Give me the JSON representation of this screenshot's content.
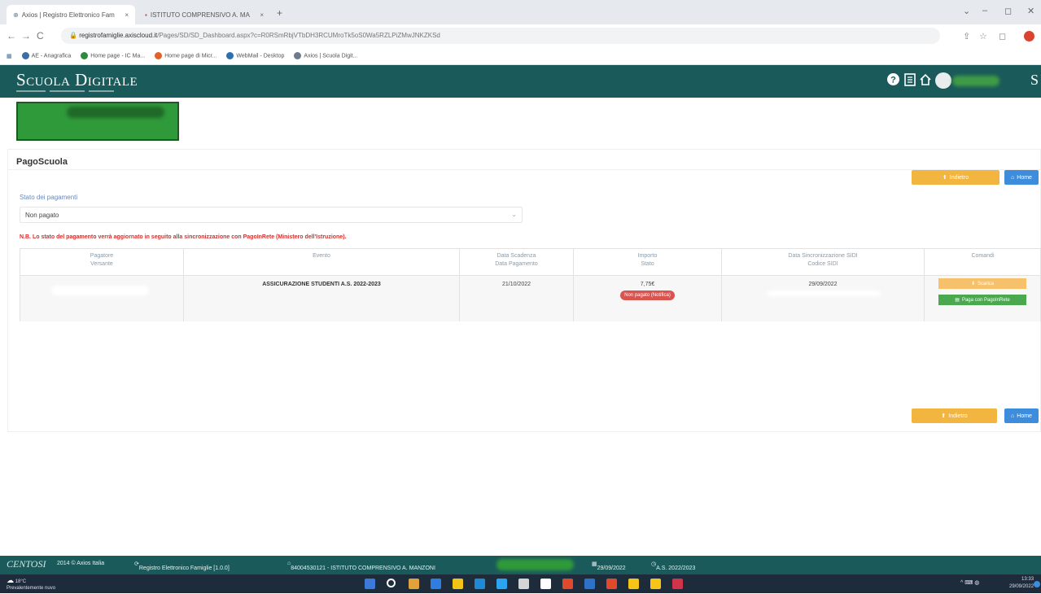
{
  "browser": {
    "tabs": [
      {
        "title": "Axios | Registro Elettronico Fam",
        "active": true,
        "close": "×"
      },
      {
        "title": "ISTITUTO COMPRENSIVO A. MA",
        "active": false,
        "close": "×"
      }
    ],
    "new_tab": "+",
    "window_controls": [
      "⌄",
      "–",
      "◻",
      "✕"
    ],
    "nav": {
      "back": "←",
      "forward": "→",
      "reload": "C"
    },
    "url_host": "registrofamiglie.axiscloud.it",
    "url_path": "/Pages/SD/SD_Dashboard.aspx?c=R0RSmRbjVTbDH3RCUMroTk5oS0Wa5RZLPiZMwJNKZKSd",
    "url_icons": [
      "⇪",
      "☆",
      "◻"
    ],
    "bookmarks": [
      "AE - Anagrafica",
      "Home page - IC Ma...",
      "Home page di Micr...",
      "WebMail - Desktop",
      "Axios | Scuola Digit..."
    ],
    "bookmark_colors": [
      "#3a6ea5",
      "#2d8a3e",
      "#e0622b",
      "#2d6fb0",
      "#6b7c8a"
    ]
  },
  "app": {
    "brand": "Scuola Digitale",
    "header_icons": [
      "?",
      "▤",
      "⌂"
    ],
    "header_letter": "S",
    "section_title": "PagoScuola",
    "back_label": "Indietro",
    "home_label": "Home",
    "stato_label": "Stato dei pagamenti",
    "stato_value": "Non pagato",
    "note": "N.B. Lo stato del pagamento verrà aggiornato in seguito alla sincronizzazione con PagoInRete (Ministero dell'Istruzione).",
    "table": {
      "headers": [
        [
          "Pagatore",
          "Versante"
        ],
        [
          "",
          "Evento"
        ],
        [
          "Data Scadenza",
          "Data Pagamento"
        ],
        [
          "Importo",
          "Stato"
        ],
        [
          "Data Sincronizzazione SIDI",
          "Codice SIDI"
        ],
        [
          "",
          "Comandi"
        ]
      ],
      "rows": [
        {
          "evento": "ASSICURAZIONE STUDENTI A.S. 2022-2023",
          "scadenza": "21/10/2022",
          "importo": "7,75€",
          "stato": "Non pagato (Notifica)",
          "data_sync": "29/09/2022",
          "cmd_1": "Scarica",
          "cmd_2": "Paga con PagoInRete"
        }
      ]
    }
  },
  "footer": {
    "logo": "CENTOSI",
    "copyright": "2014 © Axios Italia",
    "product": "Registro Elettronico Famiglie [1.0.0]",
    "school": "84004530121 - ISTITUTO COMPRENSIVO A. MANZONI",
    "date": "29/09/2022",
    "year": "A.S. 2022/2023"
  },
  "taskbar": {
    "weather_temp": "18°C",
    "weather_desc": "Prevalentemente nuvoloso",
    "time": "13:33",
    "date": "29/09/2022",
    "tray": "^ ⌨ ◍",
    "app_colors": [
      "#3b7ad9",
      "#ffffff",
      "#e2a23b",
      "#2f7de0",
      "#f0c419",
      "#1e8ad6",
      "#2aa3f0",
      "#d4d4d4",
      "#ffffff",
      "#e04a2b",
      "#2b72c8",
      "#e04a2b",
      "#f5c518",
      "#f5c518",
      "#d1344a"
    ]
  }
}
